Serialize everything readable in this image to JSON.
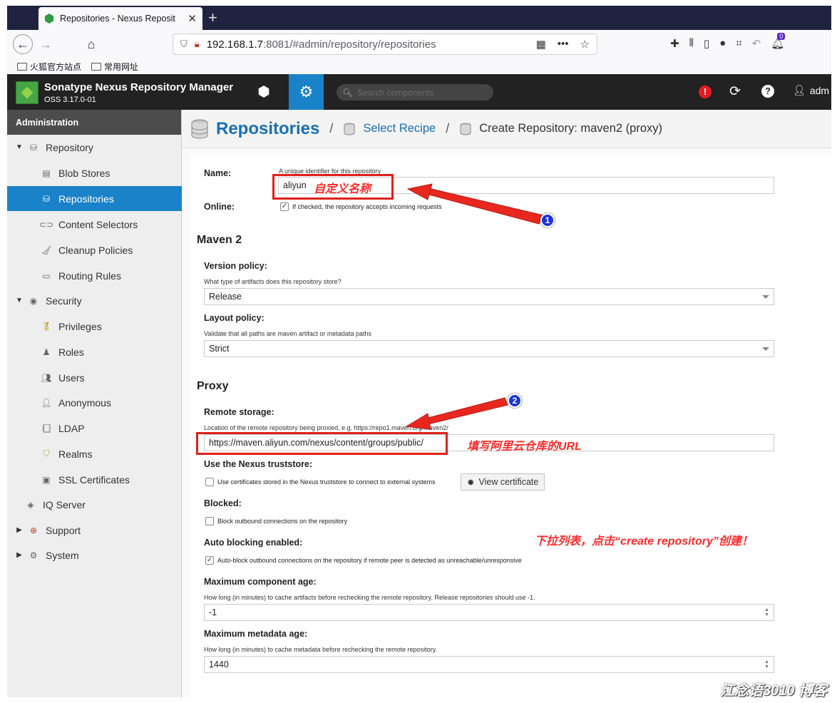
{
  "browser": {
    "tab_title": "Repositories - Nexus Reposit",
    "url_host": "192.168.1.7",
    "url_rest": ":8081/#admin/repository/repositories",
    "bookmarks": [
      "火狐官方站点",
      "常用网址"
    ],
    "notification_count": "0"
  },
  "header": {
    "app_name": "Sonatype Nexus Repository Manager",
    "version": "OSS 3.17.0-01",
    "search_placeholder": "Search components",
    "user": "adm"
  },
  "sidebar": {
    "title": "Administration",
    "items": [
      {
        "label": "Repository",
        "icon": "database-icon"
      },
      {
        "label": "Blob Stores",
        "icon": "server-icon"
      },
      {
        "label": "Repositories",
        "icon": "database-icon"
      },
      {
        "label": "Content Selectors",
        "icon": "link-icon"
      },
      {
        "label": "Cleanup Policies",
        "icon": "broom-icon"
      },
      {
        "label": "Routing Rules",
        "icon": "route-icon"
      },
      {
        "label": "Security",
        "icon": "eye-icon"
      },
      {
        "label": "Privileges",
        "icon": "badge-icon"
      },
      {
        "label": "Roles",
        "icon": "role-icon"
      },
      {
        "label": "Users",
        "icon": "users-icon"
      },
      {
        "label": "Anonymous",
        "icon": "user-icon"
      },
      {
        "label": "LDAP",
        "icon": "book-icon"
      },
      {
        "label": "Realms",
        "icon": "shield-icon"
      },
      {
        "label": "SSL Certificates",
        "icon": "certificate-icon"
      },
      {
        "label": "IQ Server",
        "icon": "iq-icon"
      },
      {
        "label": "Support",
        "icon": "lifebuoy-icon"
      },
      {
        "label": "System",
        "icon": "gear-icon"
      }
    ]
  },
  "breadcrumb": {
    "root": "Repositories",
    "step2": "Select Recipe",
    "current": "Create Repository: maven2 (proxy)"
  },
  "form": {
    "name_label": "Name:",
    "name_help": "A unique identifier for this repository",
    "name_value": "aliyun",
    "online_label": "Online:",
    "online_help": "If checked, the repository accepts incoming requests",
    "maven_section": "Maven 2",
    "version_policy_label": "Version policy:",
    "version_policy_help": "What type of artifacts does this repository store?",
    "version_policy_value": "Release",
    "layout_policy_label": "Layout policy:",
    "layout_policy_help": "Validate that all paths are maven artifact or metadata paths",
    "layout_policy_value": "Strict",
    "proxy_section": "Proxy",
    "remote_storage_label": "Remote storage:",
    "remote_storage_help": "Location of the remote repository being proxied, e.g. https://repo1.maven.org/maven2/",
    "remote_storage_value": "https://maven.aliyun.com/nexus/content/groups/public/",
    "truststore_label": "Use the Nexus truststore:",
    "truststore_help": "Use certificates stored in the Nexus truststore to connect to external systems",
    "view_cert_button": "View certificate",
    "blocked_label": "Blocked:",
    "blocked_help": "Block outbound connections on the repository",
    "auto_block_label": "Auto blocking enabled:",
    "auto_block_help": "Auto-block outbound connections on the repository if remote peer is detected as unreachable/unresponsive",
    "max_component_age_label": "Maximum component age:",
    "max_component_age_help": "How long (in minutes) to cache artifacts before rechecking the remote repository. Release repositories should use -1.",
    "max_component_age_value": "-1",
    "max_metadata_age_label": "Maximum metadata age:",
    "max_metadata_age_help": "How long (in minutes) to cache metadata before rechecking the remote repository.",
    "max_metadata_age_value": "1440"
  },
  "annotations": {
    "note1": "自定义名称",
    "note2": "填写阿里云仓库的URL",
    "note3": "下拉列表，点击“create repository”创建！",
    "badge1": "1",
    "badge2": "2",
    "watermark": "江念语3010 博客"
  },
  "colors": {
    "accent": "#1a82c8",
    "annotation_red": "#e0201a",
    "badge_blue": "#1d35d4"
  }
}
